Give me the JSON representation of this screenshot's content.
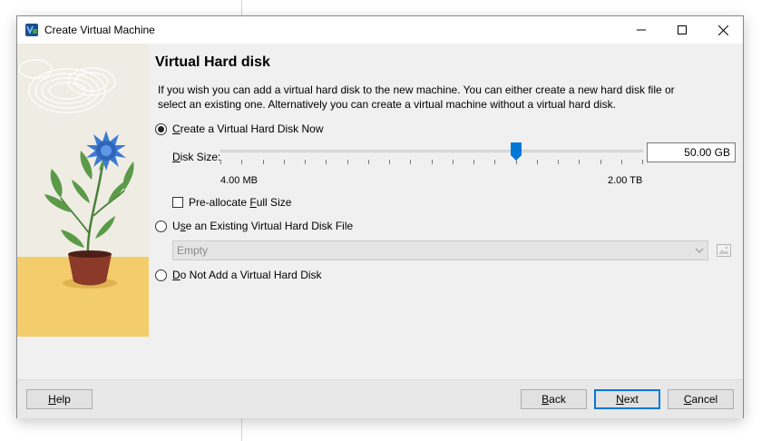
{
  "window": {
    "title": "Create Virtual Machine",
    "controls": [
      "minimize",
      "maximize",
      "close"
    ]
  },
  "page": {
    "heading": "Virtual Hard disk",
    "description": "If you wish you can add a virtual hard disk to the new machine. You can either create a new hard disk file or select an existing one. Alternatively you can create a virtual machine without a virtual hard disk."
  },
  "options": {
    "create_now": {
      "pre": "",
      "mnemonic": "C",
      "post": "reate a Virtual Hard Disk Now",
      "checked": true
    },
    "use_existing": {
      "pre": "U",
      "mnemonic": "s",
      "post": "e an Existing Virtual Hard Disk File",
      "checked": false
    },
    "do_not_add": {
      "pre": "",
      "mnemonic": "D",
      "post": "o Not Add a Virtual Hard Disk",
      "checked": false
    }
  },
  "disk_size": {
    "label_mnemonic": "D",
    "label_rest": "isk Size:",
    "value": "50.00 GB",
    "slider_fraction": 0.7,
    "min_label": "4.00 MB",
    "max_label": "2.00 TB"
  },
  "preallocate": {
    "pre": "Pre-allocate ",
    "mnemonic": "F",
    "post": "ull Size",
    "checked": false
  },
  "existing_file": {
    "selected": "Empty",
    "enabled": false
  },
  "buttons": {
    "help": {
      "mnemonic": "H",
      "rest": "elp"
    },
    "back": {
      "mnemonic": "B",
      "rest": "ack"
    },
    "next": {
      "mnemonic": "N",
      "rest": "ext"
    },
    "cancel": {
      "mnemonic": "C",
      "rest": "ancel"
    }
  },
  "colors": {
    "window_bg": "#f0f0f0",
    "accent": "#0078d7",
    "flower": "#3a7bd5",
    "pot": "#8b3a2a",
    "ground": "#f3cc6b"
  }
}
